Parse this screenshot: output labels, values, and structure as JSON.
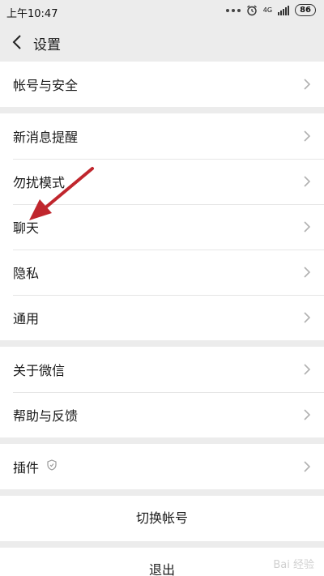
{
  "status_bar": {
    "time": "上午10:47",
    "network": "4G",
    "battery": "86"
  },
  "header": {
    "title": "设置"
  },
  "groups": [
    {
      "items": [
        "帐号与安全"
      ]
    },
    {
      "items": [
        "新消息提醒",
        "勿扰模式",
        "聊天",
        "隐私",
        "通用"
      ]
    },
    {
      "items": [
        "关于微信",
        "帮助与反馈"
      ]
    },
    {
      "items": [
        "插件"
      ]
    }
  ],
  "actions": {
    "switch_account": "切换帐号",
    "logout": "退出"
  },
  "watermark": "Bai 经验"
}
